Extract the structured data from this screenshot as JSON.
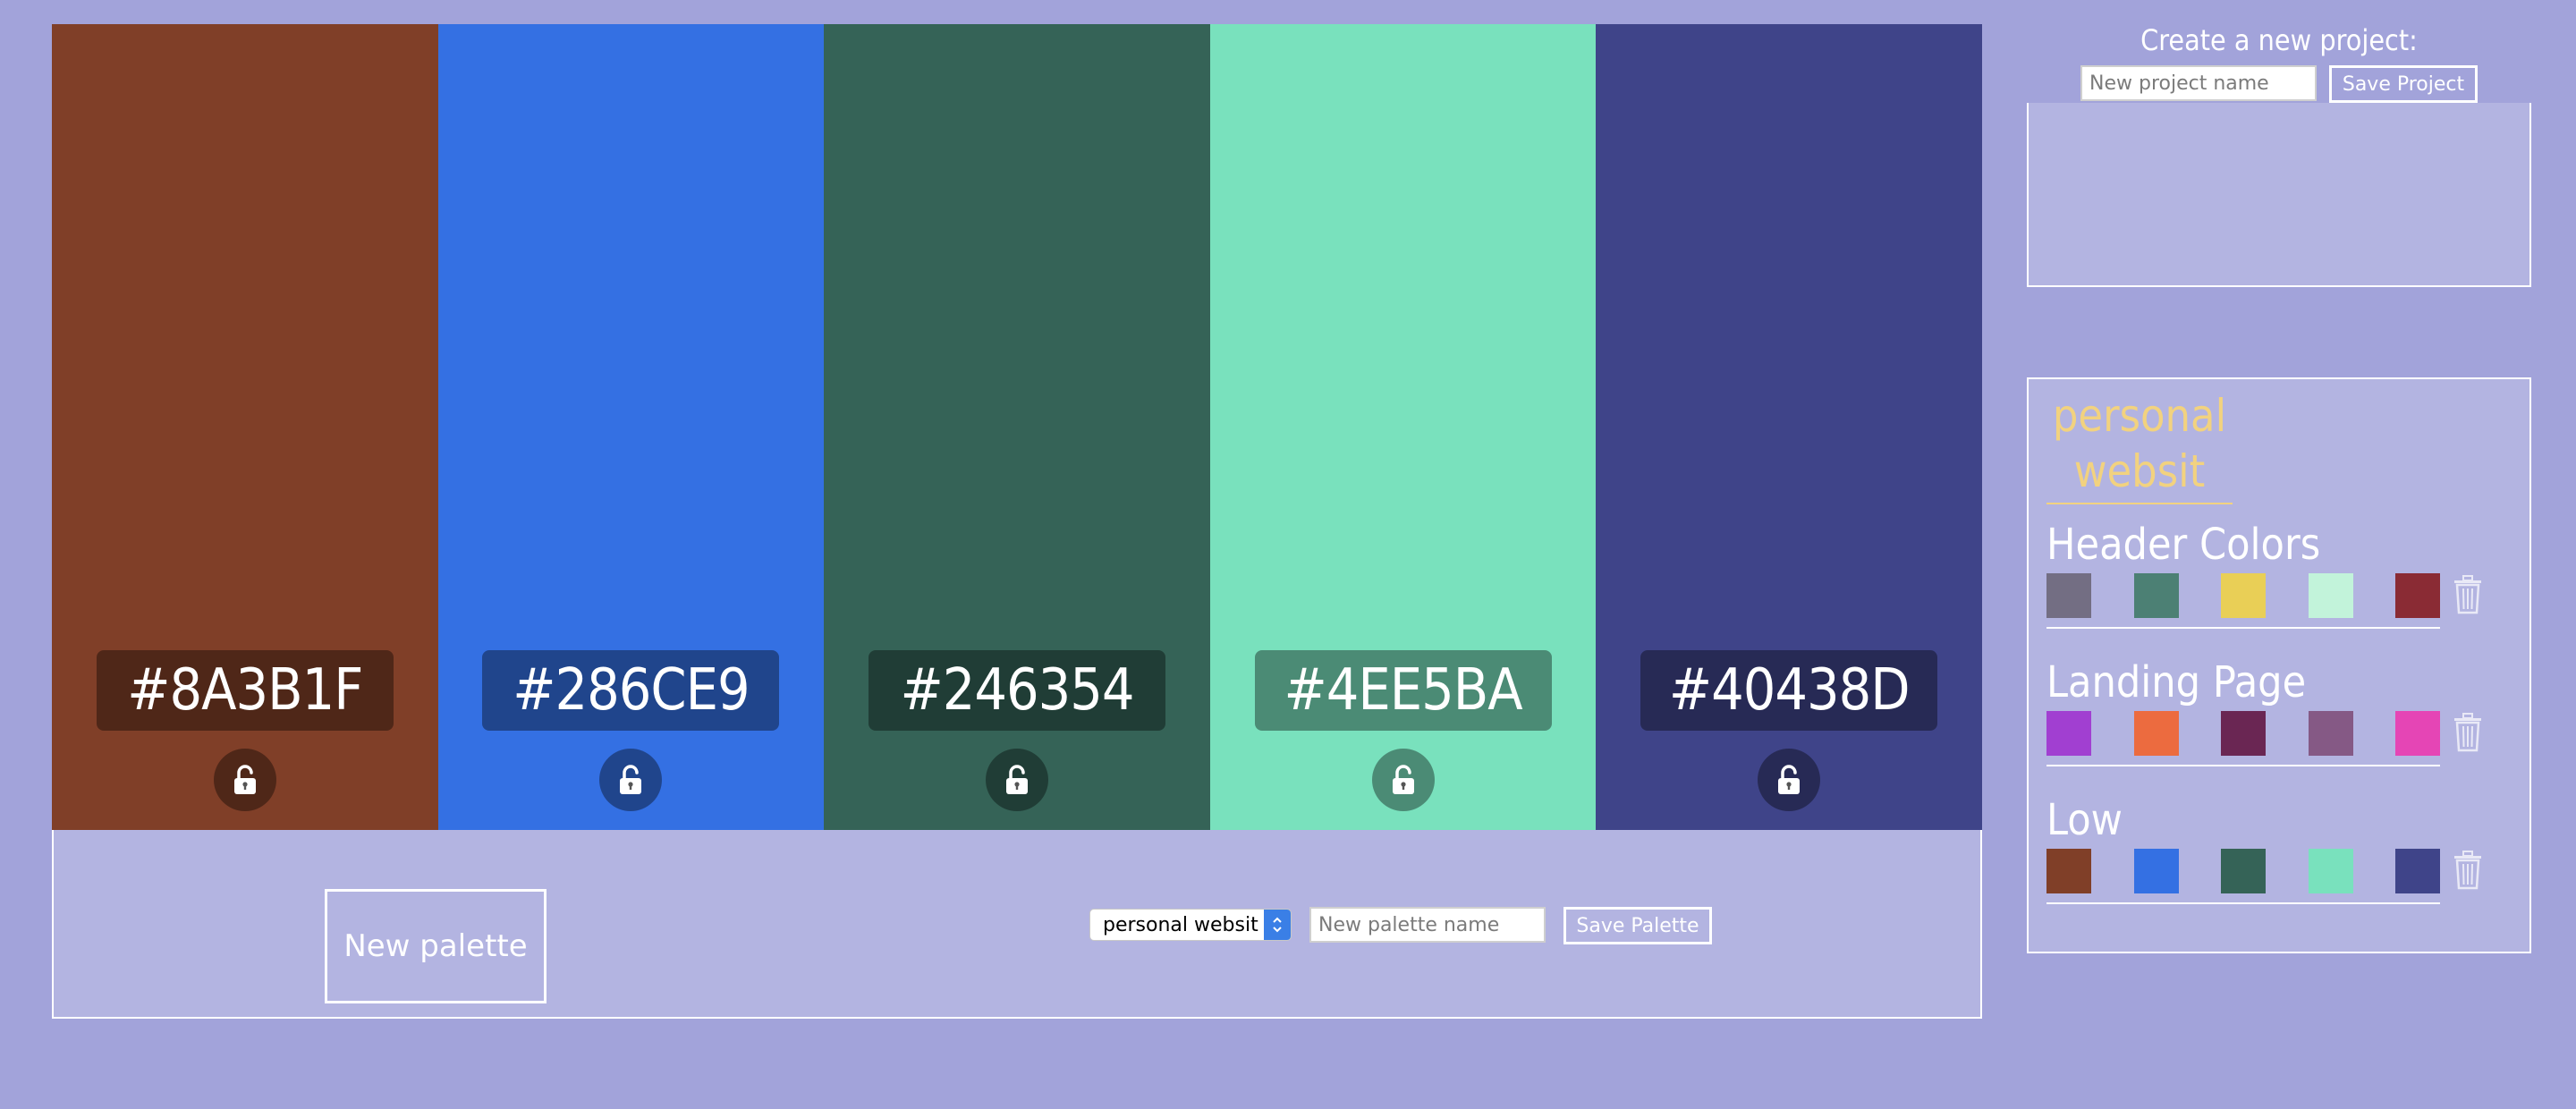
{
  "palette": {
    "swatches": [
      {
        "hex": "#8A3B1F",
        "color": "#803f28",
        "locked": false
      },
      {
        "hex": "#286CE9",
        "color": "#3470e3",
        "locked": false
      },
      {
        "hex": "#246354",
        "color": "#356357",
        "locked": false
      },
      {
        "hex": "#4EE5BA",
        "color": "#79e1bd",
        "locked": false
      },
      {
        "hex": "#40438D",
        "color": "#3f4489",
        "locked": false
      }
    ]
  },
  "controls": {
    "new_palette_label": "New palette",
    "project_select_value": "personal websit",
    "palette_name_placeholder": "New palette name",
    "save_palette_label": "Save Palette"
  },
  "new_project": {
    "title": "Create a new project:",
    "name_placeholder": "New project name",
    "save_label": "Save Project"
  },
  "saved": {
    "project_title": "personal websit",
    "palettes": [
      {
        "name": "Header Colors",
        "colors": [
          "#736e83",
          "#4c8074",
          "#e9cf56",
          "#c2f3da",
          "#8a2b34"
        ]
      },
      {
        "name": "Landing Page",
        "colors": [
          "#a13fd1",
          "#ec6b3f",
          "#6a2653",
          "#855985",
          "#e545b5"
        ]
      },
      {
        "name": "Low",
        "colors": [
          "#803f28",
          "#3470e3",
          "#356357",
          "#79e1bd",
          "#3f4489"
        ]
      }
    ]
  },
  "icons": {
    "lock": "unlocked-padlock-icon",
    "trash": "trash-icon",
    "select_arrow": "updown-chevron-icon"
  }
}
